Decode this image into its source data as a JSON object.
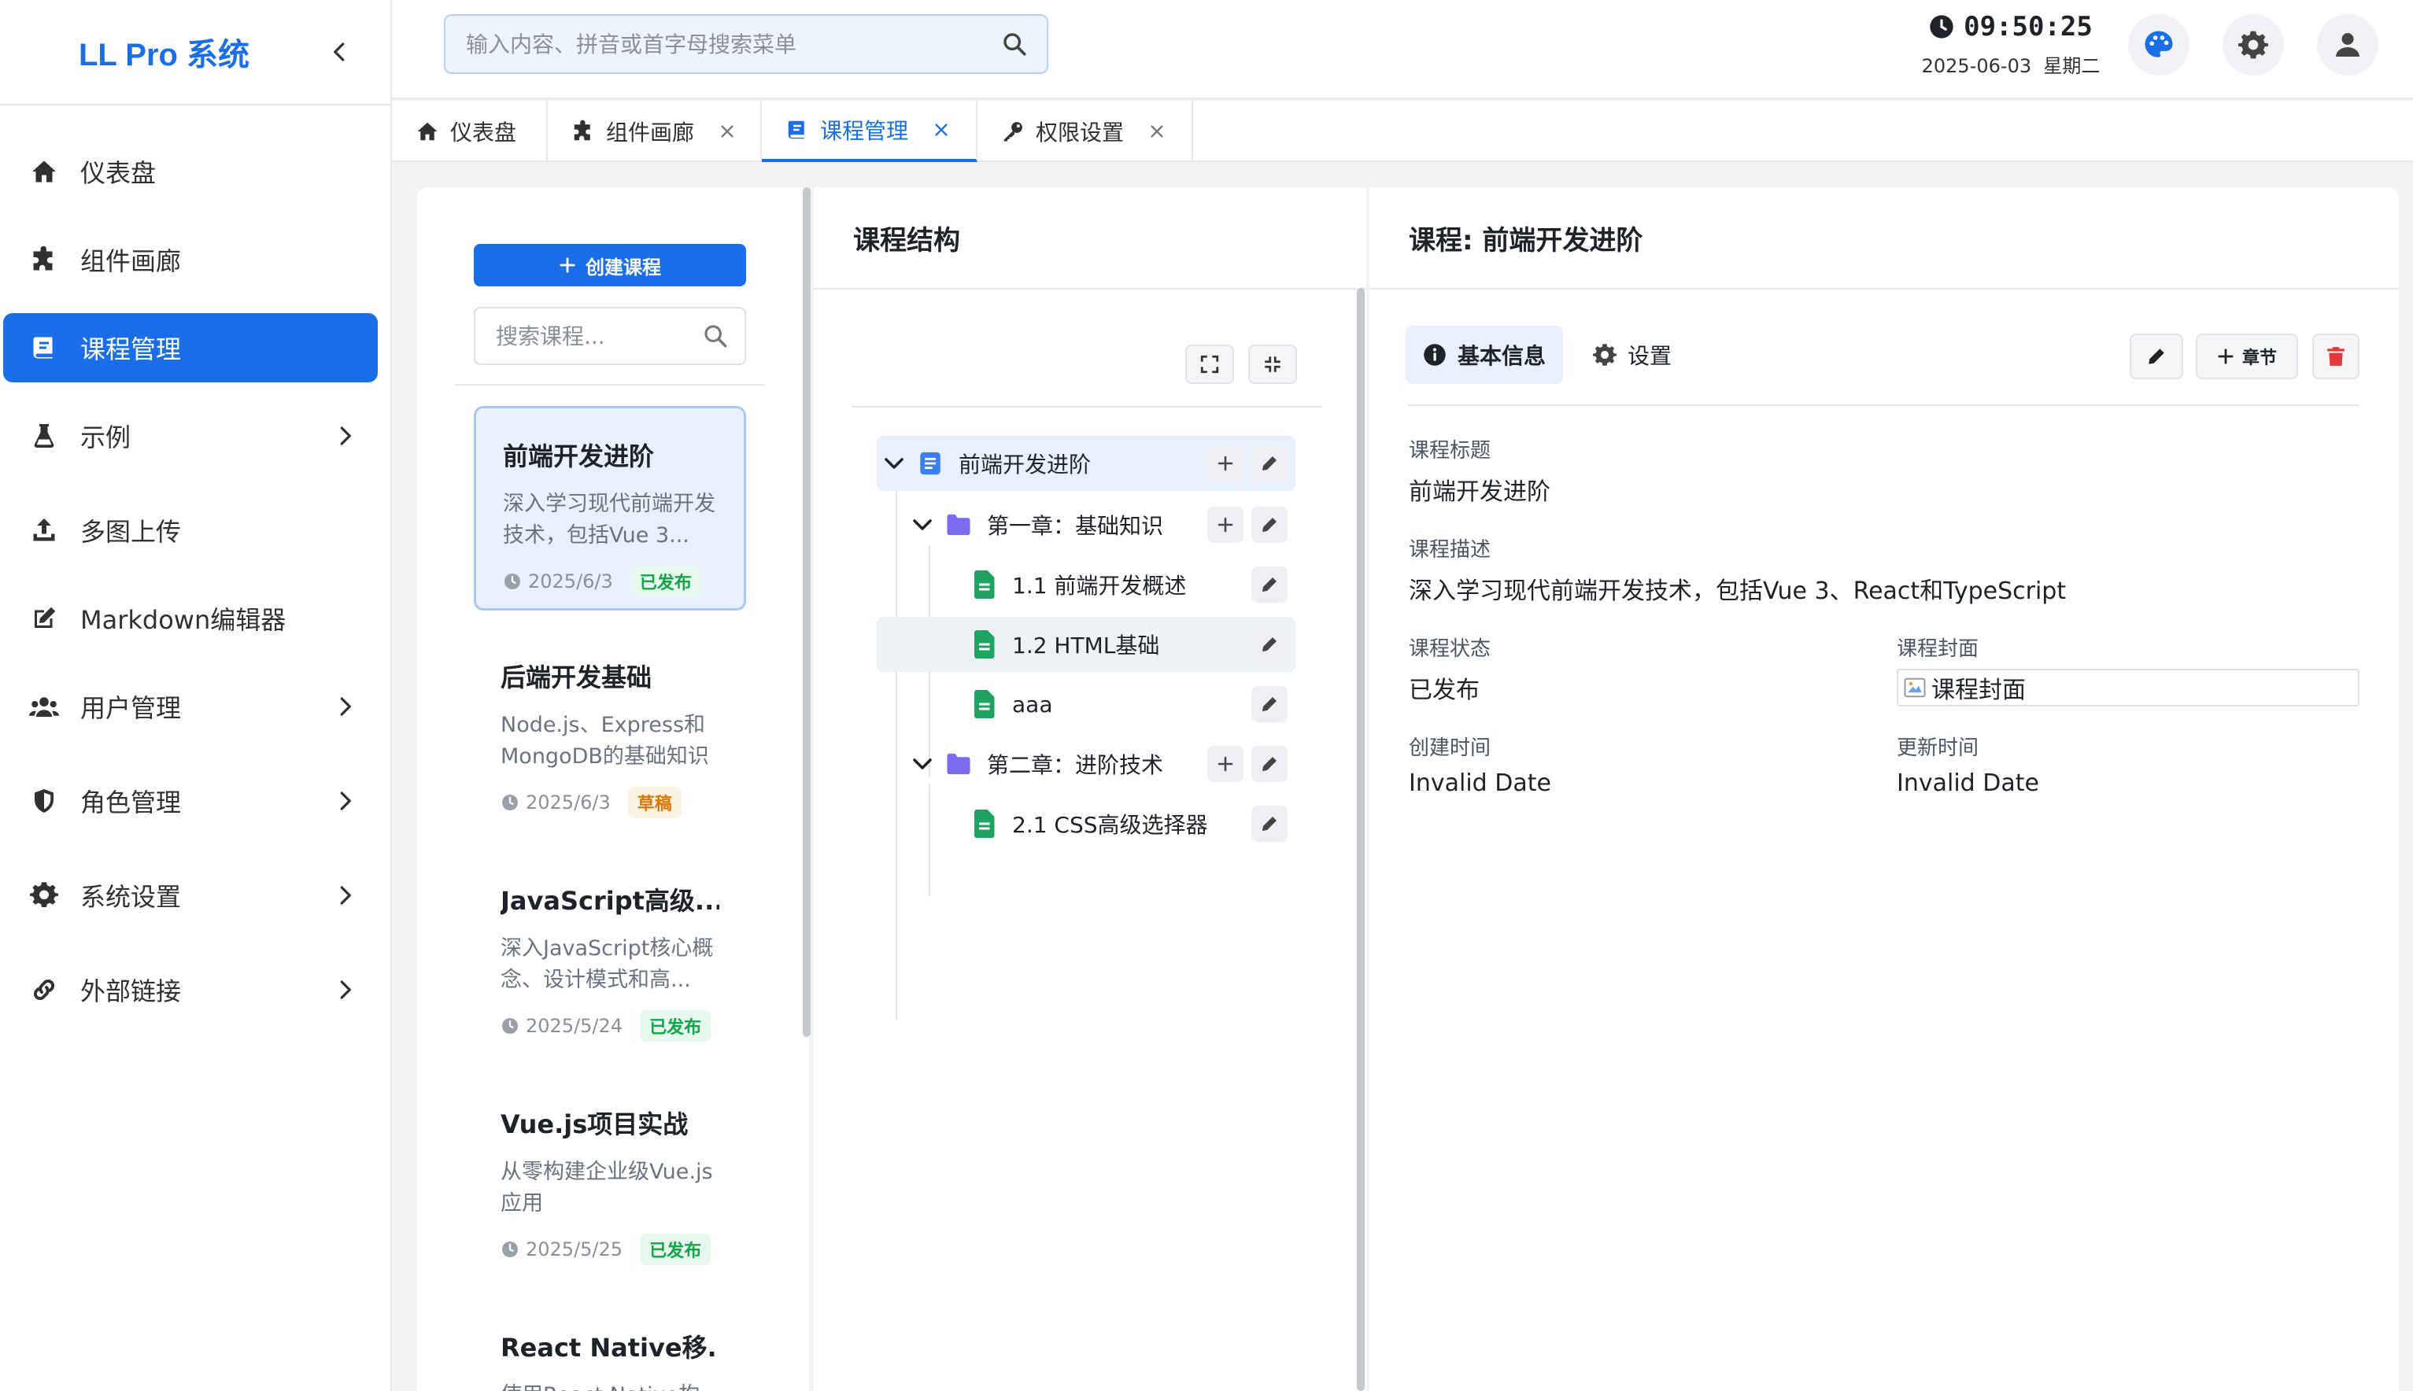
{
  "brand": {
    "name": "LL Pro 系统"
  },
  "colors": {
    "primary": "#1a6fe8",
    "published": "#15a34a",
    "draft": "#d97706",
    "folder": "#7c6af0",
    "file": "#1ea362",
    "danger": "#e5383b"
  },
  "sidebar": {
    "items": [
      {
        "label": "仪表盘",
        "icon": "home-icon"
      },
      {
        "label": "组件画廊",
        "icon": "puzzle-icon"
      },
      {
        "label": "课程管理",
        "icon": "book-icon",
        "active": true
      },
      {
        "label": "示例",
        "icon": "flask-icon",
        "has_children": true
      },
      {
        "label": "多图上传",
        "icon": "upload-icon"
      },
      {
        "label": "Markdown编辑器",
        "icon": "edit-icon"
      },
      {
        "label": "用户管理",
        "icon": "users-icon",
        "has_children": true
      },
      {
        "label": "角色管理",
        "icon": "shield-icon",
        "has_children": true
      },
      {
        "label": "系统设置",
        "icon": "gear-icon",
        "has_children": true
      },
      {
        "label": "外部链接",
        "icon": "link-icon",
        "has_children": true
      }
    ]
  },
  "header": {
    "search_placeholder": "输入内容、拼音或首字母搜索菜单",
    "time": "09:50:25",
    "date": "2025-06-03",
    "weekday": "星期二"
  },
  "tabs": [
    {
      "label": "仪表盘",
      "icon": "home-icon",
      "closable": false
    },
    {
      "label": "组件画廊",
      "icon": "puzzle-icon",
      "closable": true
    },
    {
      "label": "课程管理",
      "icon": "book-icon",
      "closable": true,
      "active": true
    },
    {
      "label": "权限设置",
      "icon": "key-icon",
      "closable": true
    }
  ],
  "course_list": {
    "create_label": "创建课程",
    "search_placeholder": "搜索课程...",
    "courses": [
      {
        "title": "前端开发进阶",
        "desc": "深入学习现代前端开发技术，包括Vue 3...",
        "date": "2025/6/3",
        "status": "已发布",
        "status_type": "pub"
      },
      {
        "title": "后端开发基础",
        "desc": "Node.js、Express和MongoDB的基础知识",
        "date": "2025/6/3",
        "status": "草稿",
        "status_type": "draft"
      },
      {
        "title": "JavaScript高级...",
        "desc": "深入JavaScript核心概念、设计模式和高...",
        "date": "2025/5/24",
        "status": "已发布",
        "status_type": "pub"
      },
      {
        "title": "Vue.js项目实战",
        "desc": "从零构建企业级Vue.js应用",
        "date": "2025/5/25",
        "status": "已发布",
        "status_type": "pub"
      },
      {
        "title": "React Native移...",
        "desc": "使用React Native构",
        "date": "",
        "status": "",
        "status_type": ""
      }
    ]
  },
  "structure": {
    "title": "课程结构",
    "tree": [
      {
        "label": "前端开发进阶",
        "type": "course",
        "level": 0,
        "expanded": true,
        "add": true
      },
      {
        "label": "第一章：基础知识",
        "type": "chapter",
        "level": 1,
        "expanded": true,
        "add": true
      },
      {
        "label": "1.1 前端开发概述",
        "type": "lesson",
        "level": 2
      },
      {
        "label": "1.2 HTML基础",
        "type": "lesson",
        "level": 2
      },
      {
        "label": "aaa",
        "type": "lesson",
        "level": 2
      },
      {
        "label": "第二章：进阶技术",
        "type": "chapter",
        "level": 1,
        "expanded": true,
        "add": true
      },
      {
        "label": "2.1 CSS高级选择器",
        "type": "lesson",
        "level": 2
      }
    ]
  },
  "detail": {
    "title": "课程: 前端开发进阶",
    "tab_basic": "基本信息",
    "tab_settings": "设置",
    "chapter_btn": "章节",
    "fields": {
      "title_label": "课程标题",
      "title_value": "前端开发进阶",
      "desc_label": "课程描述",
      "desc_value": "深入学习现代前端开发技术，包括Vue 3、React和TypeScript",
      "status_label": "课程状态",
      "status_value": "已发布",
      "cover_label": "课程封面",
      "cover_alt": "课程封面",
      "created_label": "创建时间",
      "created_value": "Invalid Date",
      "updated_label": "更新时间",
      "updated_value": "Invalid Date"
    }
  }
}
